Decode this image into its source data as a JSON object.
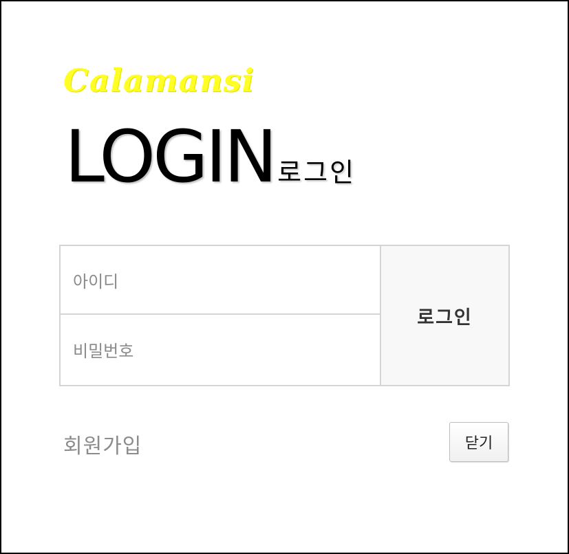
{
  "brand": {
    "logo_text": "Calamansi",
    "logo_color": "#ffff26"
  },
  "title": {
    "main": "LOGIN",
    "sub": "로그인"
  },
  "form": {
    "id_placeholder": "아이디",
    "password_placeholder": "비밀번호",
    "login_button": "로그인"
  },
  "footer": {
    "signup_link": "회원가입",
    "close_button": "닫기"
  },
  "colors": {
    "border": "#d4d4d4",
    "button_bg": "#f8f8f8",
    "placeholder_text": "#8a8a8a"
  }
}
